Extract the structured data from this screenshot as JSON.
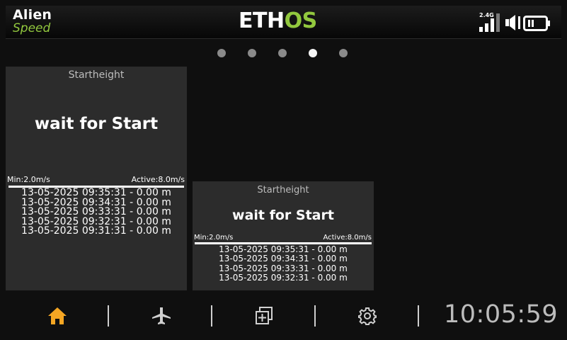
{
  "header": {
    "model_name": "Alien",
    "model_subtitle": "Speed",
    "logo_white_1": "ETH",
    "logo_green": "OS",
    "signal_label": "2.4G",
    "icons": [
      "signal-bars-icon",
      "speaker-muted-icon",
      "battery-icon"
    ]
  },
  "pagination": {
    "count": 5,
    "active_index": 3
  },
  "widgets": [
    {
      "title": "Startheight",
      "main_text": "wait for Start",
      "min_label": "Min:2.0m/s",
      "active_label": "Active:8.0m/s",
      "log": [
        "13-05-2025  09:35:31  -  0.00 m",
        "13-05-2025  09:34:31  -  0.00 m",
        "13-05-2025  09:33:31  -  0.00 m",
        "13-05-2025  09:32:31  -  0.00 m",
        "13-05-2025  09:31:31  -  0.00 m"
      ]
    },
    {
      "title": "Startheight",
      "main_text": "wait for Start",
      "min_label": "Min:2.0m/s",
      "active_label": "Active:8.0m/s",
      "log": [
        "13-05-2025  09:35:31  -  0.00 m",
        "13-05-2025  09:34:31  -  0.00 m",
        "13-05-2025  09:33:31  -  0.00 m",
        "13-05-2025  09:32:31  -  0.00 m"
      ]
    }
  ],
  "nav": {
    "items": [
      "home-icon",
      "airplane-icon",
      "add-widget-icon",
      "gear-icon"
    ],
    "active": "home-icon",
    "clock": "10:05:59"
  },
  "colors": {
    "accent_green": "#92c83e",
    "active_home": "#f5a623",
    "widget_bg": "#2c2c2c",
    "background": "#0f0f0f"
  }
}
